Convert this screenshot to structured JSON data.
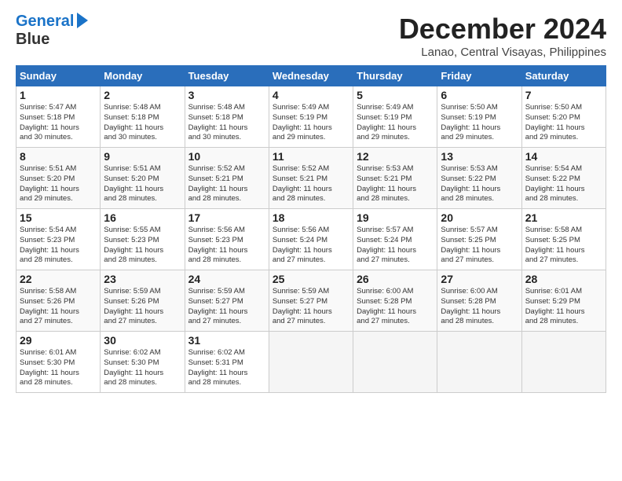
{
  "logo": {
    "line1": "General",
    "line2": "Blue"
  },
  "title": "December 2024",
  "location": "Lanao, Central Visayas, Philippines",
  "weekdays": [
    "Sunday",
    "Monday",
    "Tuesday",
    "Wednesday",
    "Thursday",
    "Friday",
    "Saturday"
  ],
  "weeks": [
    [
      {
        "day": "1",
        "info": "Sunrise: 5:47 AM\nSunset: 5:18 PM\nDaylight: 11 hours\nand 30 minutes."
      },
      {
        "day": "2",
        "info": "Sunrise: 5:48 AM\nSunset: 5:18 PM\nDaylight: 11 hours\nand 30 minutes."
      },
      {
        "day": "3",
        "info": "Sunrise: 5:48 AM\nSunset: 5:18 PM\nDaylight: 11 hours\nand 30 minutes."
      },
      {
        "day": "4",
        "info": "Sunrise: 5:49 AM\nSunset: 5:19 PM\nDaylight: 11 hours\nand 29 minutes."
      },
      {
        "day": "5",
        "info": "Sunrise: 5:49 AM\nSunset: 5:19 PM\nDaylight: 11 hours\nand 29 minutes."
      },
      {
        "day": "6",
        "info": "Sunrise: 5:50 AM\nSunset: 5:19 PM\nDaylight: 11 hours\nand 29 minutes."
      },
      {
        "day": "7",
        "info": "Sunrise: 5:50 AM\nSunset: 5:20 PM\nDaylight: 11 hours\nand 29 minutes."
      }
    ],
    [
      {
        "day": "8",
        "info": "Sunrise: 5:51 AM\nSunset: 5:20 PM\nDaylight: 11 hours\nand 29 minutes."
      },
      {
        "day": "9",
        "info": "Sunrise: 5:51 AM\nSunset: 5:20 PM\nDaylight: 11 hours\nand 28 minutes."
      },
      {
        "day": "10",
        "info": "Sunrise: 5:52 AM\nSunset: 5:21 PM\nDaylight: 11 hours\nand 28 minutes."
      },
      {
        "day": "11",
        "info": "Sunrise: 5:52 AM\nSunset: 5:21 PM\nDaylight: 11 hours\nand 28 minutes."
      },
      {
        "day": "12",
        "info": "Sunrise: 5:53 AM\nSunset: 5:21 PM\nDaylight: 11 hours\nand 28 minutes."
      },
      {
        "day": "13",
        "info": "Sunrise: 5:53 AM\nSunset: 5:22 PM\nDaylight: 11 hours\nand 28 minutes."
      },
      {
        "day": "14",
        "info": "Sunrise: 5:54 AM\nSunset: 5:22 PM\nDaylight: 11 hours\nand 28 minutes."
      }
    ],
    [
      {
        "day": "15",
        "info": "Sunrise: 5:54 AM\nSunset: 5:23 PM\nDaylight: 11 hours\nand 28 minutes."
      },
      {
        "day": "16",
        "info": "Sunrise: 5:55 AM\nSunset: 5:23 PM\nDaylight: 11 hours\nand 28 minutes."
      },
      {
        "day": "17",
        "info": "Sunrise: 5:56 AM\nSunset: 5:23 PM\nDaylight: 11 hours\nand 28 minutes."
      },
      {
        "day": "18",
        "info": "Sunrise: 5:56 AM\nSunset: 5:24 PM\nDaylight: 11 hours\nand 27 minutes."
      },
      {
        "day": "19",
        "info": "Sunrise: 5:57 AM\nSunset: 5:24 PM\nDaylight: 11 hours\nand 27 minutes."
      },
      {
        "day": "20",
        "info": "Sunrise: 5:57 AM\nSunset: 5:25 PM\nDaylight: 11 hours\nand 27 minutes."
      },
      {
        "day": "21",
        "info": "Sunrise: 5:58 AM\nSunset: 5:25 PM\nDaylight: 11 hours\nand 27 minutes."
      }
    ],
    [
      {
        "day": "22",
        "info": "Sunrise: 5:58 AM\nSunset: 5:26 PM\nDaylight: 11 hours\nand 27 minutes."
      },
      {
        "day": "23",
        "info": "Sunrise: 5:59 AM\nSunset: 5:26 PM\nDaylight: 11 hours\nand 27 minutes."
      },
      {
        "day": "24",
        "info": "Sunrise: 5:59 AM\nSunset: 5:27 PM\nDaylight: 11 hours\nand 27 minutes."
      },
      {
        "day": "25",
        "info": "Sunrise: 5:59 AM\nSunset: 5:27 PM\nDaylight: 11 hours\nand 27 minutes."
      },
      {
        "day": "26",
        "info": "Sunrise: 6:00 AM\nSunset: 5:28 PM\nDaylight: 11 hours\nand 27 minutes."
      },
      {
        "day": "27",
        "info": "Sunrise: 6:00 AM\nSunset: 5:28 PM\nDaylight: 11 hours\nand 28 minutes."
      },
      {
        "day": "28",
        "info": "Sunrise: 6:01 AM\nSunset: 5:29 PM\nDaylight: 11 hours\nand 28 minutes."
      }
    ],
    [
      {
        "day": "29",
        "info": "Sunrise: 6:01 AM\nSunset: 5:30 PM\nDaylight: 11 hours\nand 28 minutes."
      },
      {
        "day": "30",
        "info": "Sunrise: 6:02 AM\nSunset: 5:30 PM\nDaylight: 11 hours\nand 28 minutes."
      },
      {
        "day": "31",
        "info": "Sunrise: 6:02 AM\nSunset: 5:31 PM\nDaylight: 11 hours\nand 28 minutes."
      },
      {
        "day": "",
        "info": ""
      },
      {
        "day": "",
        "info": ""
      },
      {
        "day": "",
        "info": ""
      },
      {
        "day": "",
        "info": ""
      }
    ]
  ]
}
